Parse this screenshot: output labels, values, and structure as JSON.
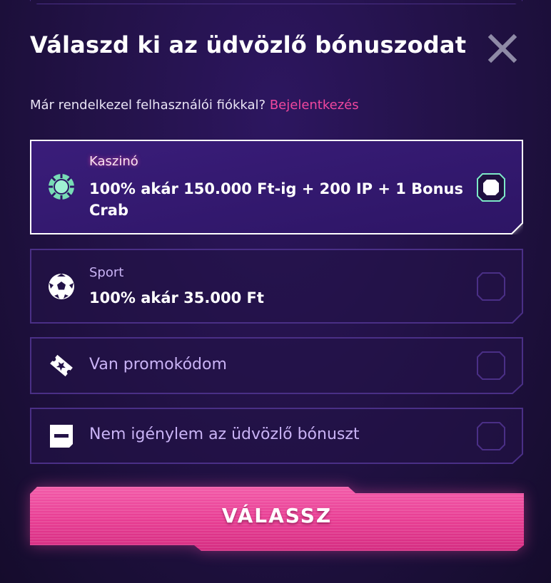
{
  "modal": {
    "title": "Válaszd ki az üdvözlő bónuszodat",
    "close_icon": "close-icon",
    "login_prompt": "Már rendelkezel felhasználói fiókkal?",
    "login_link": "Bejelentkezés"
  },
  "options": [
    {
      "icon": "casino-chip-icon",
      "label": "Kaszinó",
      "description": "100% akár 150.000 Ft-ig + 200 IP + 1 Bonus Crab",
      "selected": true
    },
    {
      "icon": "soccer-ball-icon",
      "label": "Sport",
      "description": "100% akár 35.000 Ft",
      "selected": false
    },
    {
      "icon": "promo-ticket-icon",
      "label": "Van promokódom",
      "selected": false
    },
    {
      "icon": "no-bonus-icon",
      "label": "Nem igénylem az üdvözlő bónuszt",
      "selected": false
    }
  ],
  "submit": {
    "label": "VÁLASSZ"
  },
  "colors": {
    "accent_pink": "#f0479e",
    "selected_border": "#ffffff",
    "selected_radio": "#7de8c8",
    "card_border": "#4a2f86",
    "label_purple": "#c9b3f5",
    "background": "#231248"
  }
}
